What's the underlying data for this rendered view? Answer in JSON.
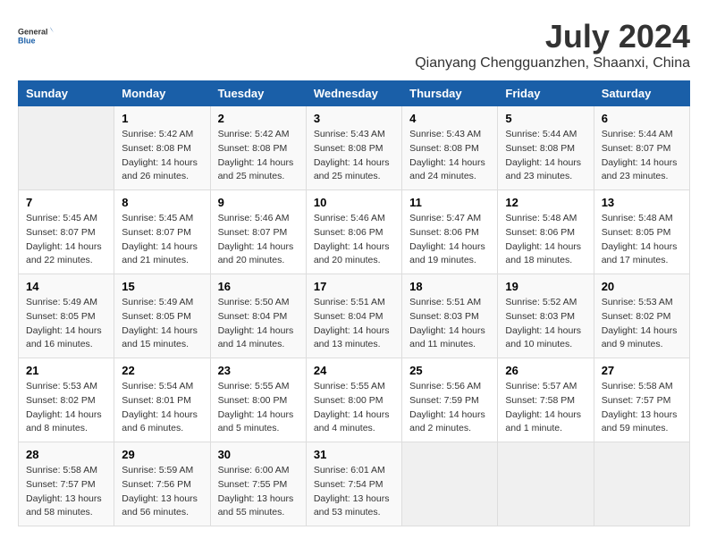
{
  "logo": {
    "line1": "General",
    "line2": "Blue"
  },
  "title": "July 2024",
  "location": "Qianyang Chengguanzhen, Shaanxi, China",
  "days_of_week": [
    "Sunday",
    "Monday",
    "Tuesday",
    "Wednesday",
    "Thursday",
    "Friday",
    "Saturday"
  ],
  "weeks": [
    [
      {
        "day": "",
        "info": ""
      },
      {
        "day": "1",
        "info": "Sunrise: 5:42 AM\nSunset: 8:08 PM\nDaylight: 14 hours\nand 26 minutes."
      },
      {
        "day": "2",
        "info": "Sunrise: 5:42 AM\nSunset: 8:08 PM\nDaylight: 14 hours\nand 25 minutes."
      },
      {
        "day": "3",
        "info": "Sunrise: 5:43 AM\nSunset: 8:08 PM\nDaylight: 14 hours\nand 25 minutes."
      },
      {
        "day": "4",
        "info": "Sunrise: 5:43 AM\nSunset: 8:08 PM\nDaylight: 14 hours\nand 24 minutes."
      },
      {
        "day": "5",
        "info": "Sunrise: 5:44 AM\nSunset: 8:08 PM\nDaylight: 14 hours\nand 23 minutes."
      },
      {
        "day": "6",
        "info": "Sunrise: 5:44 AM\nSunset: 8:07 PM\nDaylight: 14 hours\nand 23 minutes."
      }
    ],
    [
      {
        "day": "7",
        "info": "Sunrise: 5:45 AM\nSunset: 8:07 PM\nDaylight: 14 hours\nand 22 minutes."
      },
      {
        "day": "8",
        "info": "Sunrise: 5:45 AM\nSunset: 8:07 PM\nDaylight: 14 hours\nand 21 minutes."
      },
      {
        "day": "9",
        "info": "Sunrise: 5:46 AM\nSunset: 8:07 PM\nDaylight: 14 hours\nand 20 minutes."
      },
      {
        "day": "10",
        "info": "Sunrise: 5:46 AM\nSunset: 8:06 PM\nDaylight: 14 hours\nand 20 minutes."
      },
      {
        "day": "11",
        "info": "Sunrise: 5:47 AM\nSunset: 8:06 PM\nDaylight: 14 hours\nand 19 minutes."
      },
      {
        "day": "12",
        "info": "Sunrise: 5:48 AM\nSunset: 8:06 PM\nDaylight: 14 hours\nand 18 minutes."
      },
      {
        "day": "13",
        "info": "Sunrise: 5:48 AM\nSunset: 8:05 PM\nDaylight: 14 hours\nand 17 minutes."
      }
    ],
    [
      {
        "day": "14",
        "info": "Sunrise: 5:49 AM\nSunset: 8:05 PM\nDaylight: 14 hours\nand 16 minutes."
      },
      {
        "day": "15",
        "info": "Sunrise: 5:49 AM\nSunset: 8:05 PM\nDaylight: 14 hours\nand 15 minutes."
      },
      {
        "day": "16",
        "info": "Sunrise: 5:50 AM\nSunset: 8:04 PM\nDaylight: 14 hours\nand 14 minutes."
      },
      {
        "day": "17",
        "info": "Sunrise: 5:51 AM\nSunset: 8:04 PM\nDaylight: 14 hours\nand 13 minutes."
      },
      {
        "day": "18",
        "info": "Sunrise: 5:51 AM\nSunset: 8:03 PM\nDaylight: 14 hours\nand 11 minutes."
      },
      {
        "day": "19",
        "info": "Sunrise: 5:52 AM\nSunset: 8:03 PM\nDaylight: 14 hours\nand 10 minutes."
      },
      {
        "day": "20",
        "info": "Sunrise: 5:53 AM\nSunset: 8:02 PM\nDaylight: 14 hours\nand 9 minutes."
      }
    ],
    [
      {
        "day": "21",
        "info": "Sunrise: 5:53 AM\nSunset: 8:02 PM\nDaylight: 14 hours\nand 8 minutes."
      },
      {
        "day": "22",
        "info": "Sunrise: 5:54 AM\nSunset: 8:01 PM\nDaylight: 14 hours\nand 6 minutes."
      },
      {
        "day": "23",
        "info": "Sunrise: 5:55 AM\nSunset: 8:00 PM\nDaylight: 14 hours\nand 5 minutes."
      },
      {
        "day": "24",
        "info": "Sunrise: 5:55 AM\nSunset: 8:00 PM\nDaylight: 14 hours\nand 4 minutes."
      },
      {
        "day": "25",
        "info": "Sunrise: 5:56 AM\nSunset: 7:59 PM\nDaylight: 14 hours\nand 2 minutes."
      },
      {
        "day": "26",
        "info": "Sunrise: 5:57 AM\nSunset: 7:58 PM\nDaylight: 14 hours\nand 1 minute."
      },
      {
        "day": "27",
        "info": "Sunrise: 5:58 AM\nSunset: 7:57 PM\nDaylight: 13 hours\nand 59 minutes."
      }
    ],
    [
      {
        "day": "28",
        "info": "Sunrise: 5:58 AM\nSunset: 7:57 PM\nDaylight: 13 hours\nand 58 minutes."
      },
      {
        "day": "29",
        "info": "Sunrise: 5:59 AM\nSunset: 7:56 PM\nDaylight: 13 hours\nand 56 minutes."
      },
      {
        "day": "30",
        "info": "Sunrise: 6:00 AM\nSunset: 7:55 PM\nDaylight: 13 hours\nand 55 minutes."
      },
      {
        "day": "31",
        "info": "Sunrise: 6:01 AM\nSunset: 7:54 PM\nDaylight: 13 hours\nand 53 minutes."
      },
      {
        "day": "",
        "info": ""
      },
      {
        "day": "",
        "info": ""
      },
      {
        "day": "",
        "info": ""
      }
    ]
  ]
}
